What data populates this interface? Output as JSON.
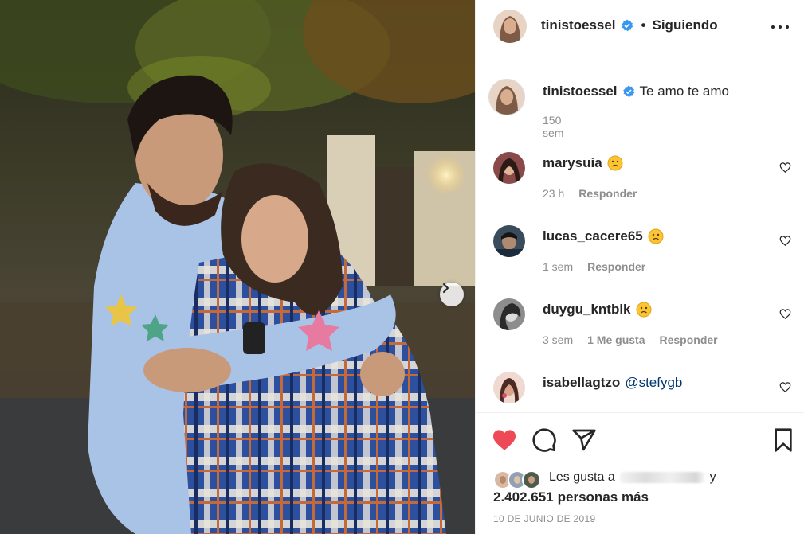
{
  "post": {
    "author": "tinistoessel",
    "follow_status": "Siguiendo",
    "separator": "•",
    "caption_text": "Te amo te amo",
    "caption_time": "150 sem",
    "date": "10 DE JUNIO DE 2019",
    "liked": true
  },
  "comments": [
    {
      "user": "marysuia",
      "text": "",
      "emoji": "sad-face-emoji",
      "time": "23 h",
      "likes_label": "",
      "reply_label": "Responder"
    },
    {
      "user": "lucas_cacere65",
      "text": "",
      "emoji": "sad-face-emoji",
      "time": "1 sem",
      "likes_label": "",
      "reply_label": "Responder"
    },
    {
      "user": "duygu_kntblk",
      "text": "",
      "emoji": "sad-face-emoji",
      "time": "3 sem",
      "likes_label": "1 Me gusta",
      "reply_label": "Responder"
    },
    {
      "user": "isabellagtzo",
      "text": "",
      "mention": "@stefygb",
      "emoji": "",
      "time": "",
      "likes_label": "",
      "reply_label": ""
    }
  ],
  "likes": {
    "prefix": "Les gusta a",
    "conjunction": "y",
    "count": "2.402.651",
    "suffix": "personas más"
  },
  "colors": {
    "heart_red": "#ed4956",
    "verified_blue": "#3897f0",
    "link_blue": "#00376b",
    "muted_gray": "#8e8e8e"
  },
  "icons": {
    "like": "heart-filled-icon",
    "comment": "comment-bubble-icon",
    "share": "paper-plane-icon",
    "save": "bookmark-icon",
    "more": "more-options-icon",
    "next": "chevron-right-icon"
  }
}
